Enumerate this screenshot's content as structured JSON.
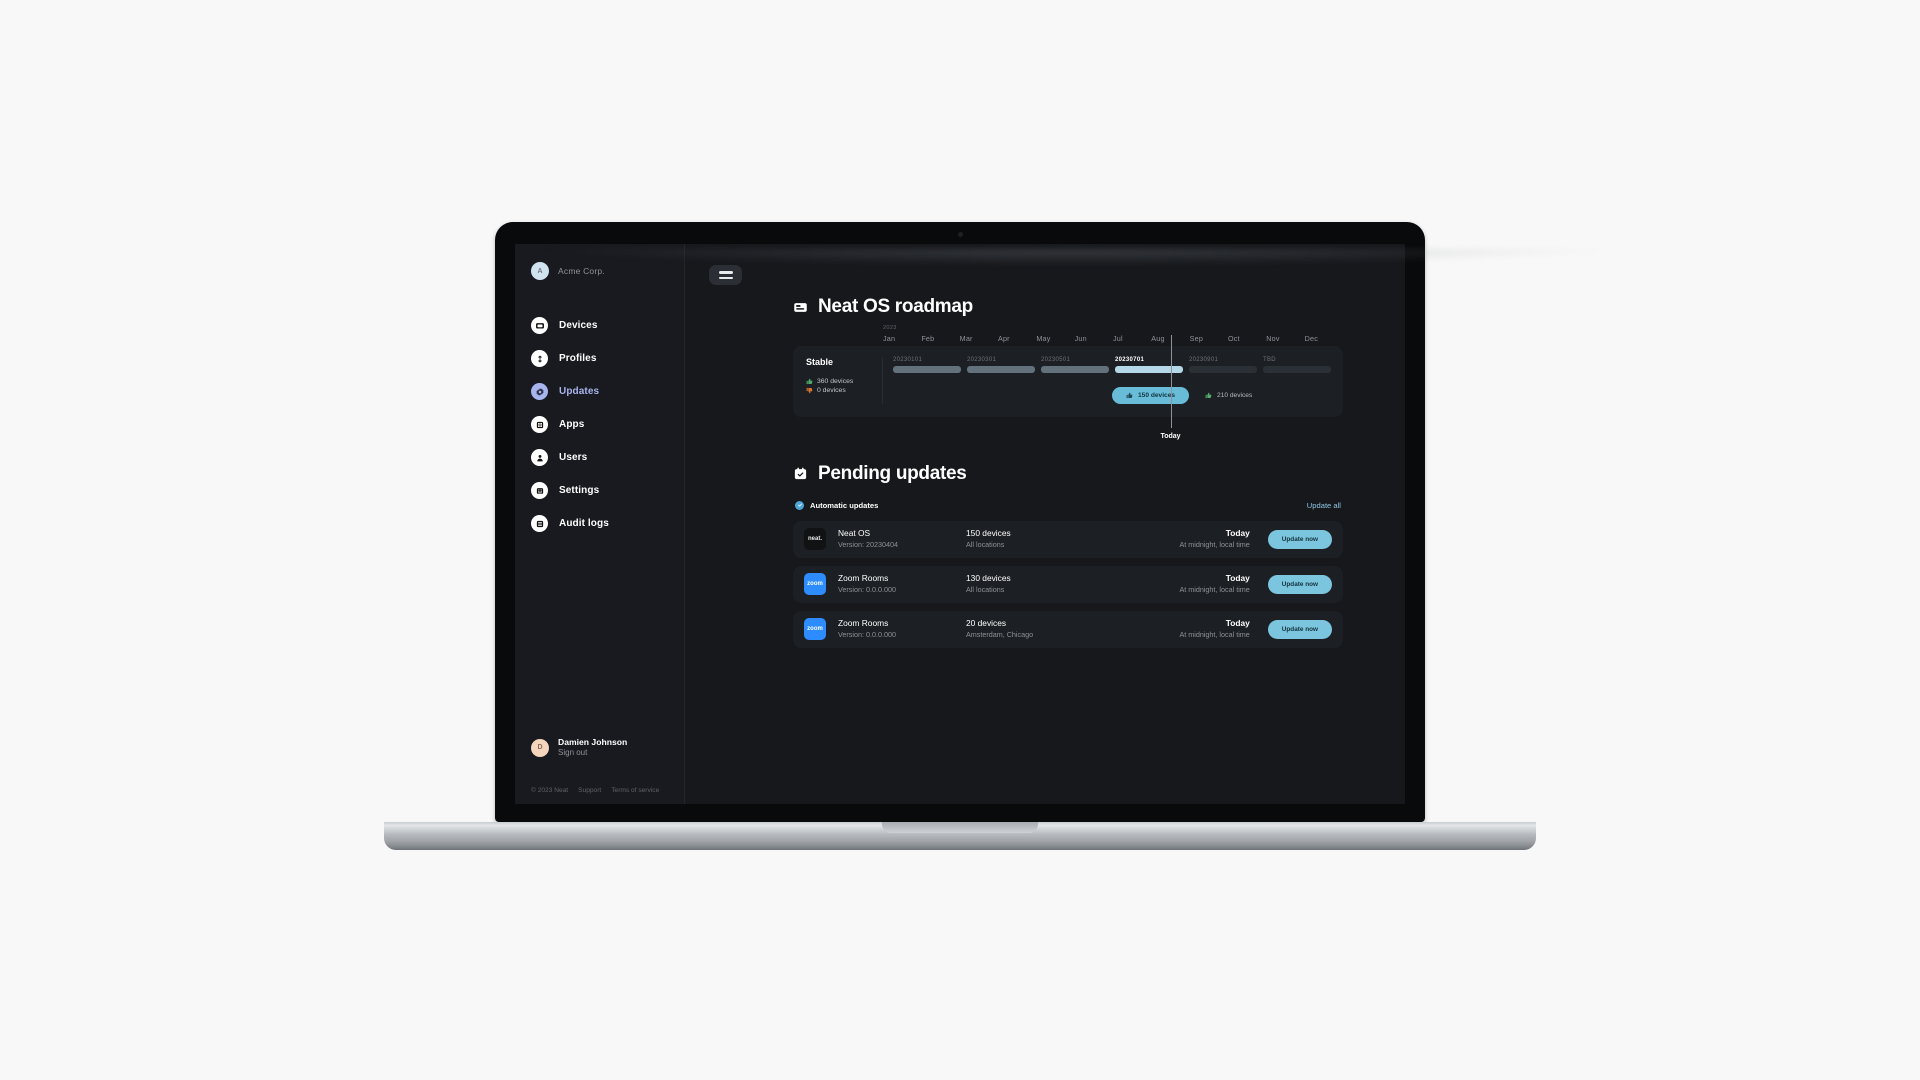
{
  "sidebar": {
    "org": {
      "avatar_letter": "A",
      "name": "Acme Corp."
    },
    "items": [
      {
        "label": "Devices",
        "icon": "devices-icon",
        "active": false
      },
      {
        "label": "Profiles",
        "icon": "profiles-icon",
        "active": false
      },
      {
        "label": "Updates",
        "icon": "updates-icon",
        "active": true
      },
      {
        "label": "Apps",
        "icon": "apps-icon",
        "active": false
      },
      {
        "label": "Users",
        "icon": "users-icon",
        "active": false
      },
      {
        "label": "Settings",
        "icon": "settings-icon",
        "active": false
      },
      {
        "label": "Audit logs",
        "icon": "audit-logs-icon",
        "active": false
      }
    ],
    "user": {
      "avatar_letter": "D",
      "name": "Damien Johnson",
      "action": "Sign out"
    },
    "footer": {
      "copyright": "© 2023 Neat",
      "support": "Support",
      "terms": "Terms of service"
    }
  },
  "header": {
    "menu_icon": "hamburger-icon"
  },
  "roadmap": {
    "title": "Neat OS roadmap",
    "title_icon": "roadmap-icon",
    "channel": "Stable",
    "up_to_date": "360 devices",
    "outdated": "0 devices",
    "today_label": "Today",
    "chart_data": {
      "type": "timeline",
      "title": "Neat OS roadmap",
      "year": "2023",
      "categories": [
        "Jan",
        "Feb",
        "Mar",
        "Apr",
        "May",
        "Jun",
        "Jul",
        "Aug",
        "Sep",
        "Oct",
        "Nov",
        "Dec"
      ],
      "xlabel": "",
      "ylabel": "",
      "today_marker": {
        "label": "Today",
        "position_month": "Aug",
        "fraction": 0.625
      },
      "channel": "Stable",
      "device_summary": [
        {
          "state": "up-to-date",
          "count": 360,
          "text": "360 devices"
        },
        {
          "state": "outdated",
          "count": 0,
          "text": "0 devices"
        }
      ],
      "releases": [
        {
          "version": "20230101",
          "start_month": "Jan",
          "span_months": 2,
          "status": "past",
          "color": "#62717c"
        },
        {
          "version": "20230301",
          "start_month": "Mar",
          "span_months": 2,
          "status": "past",
          "color": "#62717c"
        },
        {
          "version": "20230501",
          "start_month": "May",
          "span_months": 2,
          "status": "past",
          "color": "#62717c"
        },
        {
          "version": "20230701",
          "start_month": "Jul",
          "span_months": 2,
          "status": "current",
          "color": "#b4d8e8"
        },
        {
          "version": "20230901",
          "start_month": "Sep",
          "span_months": 2,
          "status": "future",
          "color": "#2b3036"
        },
        {
          "version": "TBD",
          "start_month": "Nov",
          "span_months": 2,
          "status": "future",
          "color": "#2b3036"
        }
      ],
      "annotations": [
        {
          "text": "150 devices",
          "style": "pill",
          "month": "Jun",
          "icon": "thumbs-up-icon",
          "value": 150
        },
        {
          "text": "210 devices",
          "style": "plain",
          "month": "Aug",
          "icon": "thumbs-up-icon",
          "value": 210
        }
      ],
      "colors": {
        "accent": "#68bcd8",
        "bar_past": "#62717c",
        "bar_current": "#b4d8e8",
        "bar_future": "#2b3036"
      }
    }
  },
  "pending": {
    "title": "Pending updates",
    "title_icon": "pending-updates-icon",
    "automatic_label": "Automatic updates",
    "automatic_enabled": true,
    "update_all_label": "Update all",
    "rows": [
      {
        "logo": "neat",
        "logo_text": "neat.",
        "name": "Neat OS",
        "version": "Version: 20230404",
        "devices": "150 devices",
        "locations": "All locations",
        "when": "Today",
        "when_sub": "At midnight, local time",
        "button": "Update now"
      },
      {
        "logo": "zoom",
        "logo_text": "zoom",
        "name": "Zoom Rooms",
        "version": "Version: 0.0.0.000",
        "devices": "130 devices",
        "locations": "All locations",
        "when": "Today",
        "when_sub": "At midnight, local time",
        "button": "Update now"
      },
      {
        "logo": "zoom",
        "logo_text": "zoom",
        "name": "Zoom Rooms",
        "version": "Version: 0.0.0.000",
        "devices": "20 devices",
        "locations": "Amsterdam, Chicago",
        "when": "Today",
        "when_sub": "At midnight, local time",
        "button": "Update now"
      }
    ]
  }
}
